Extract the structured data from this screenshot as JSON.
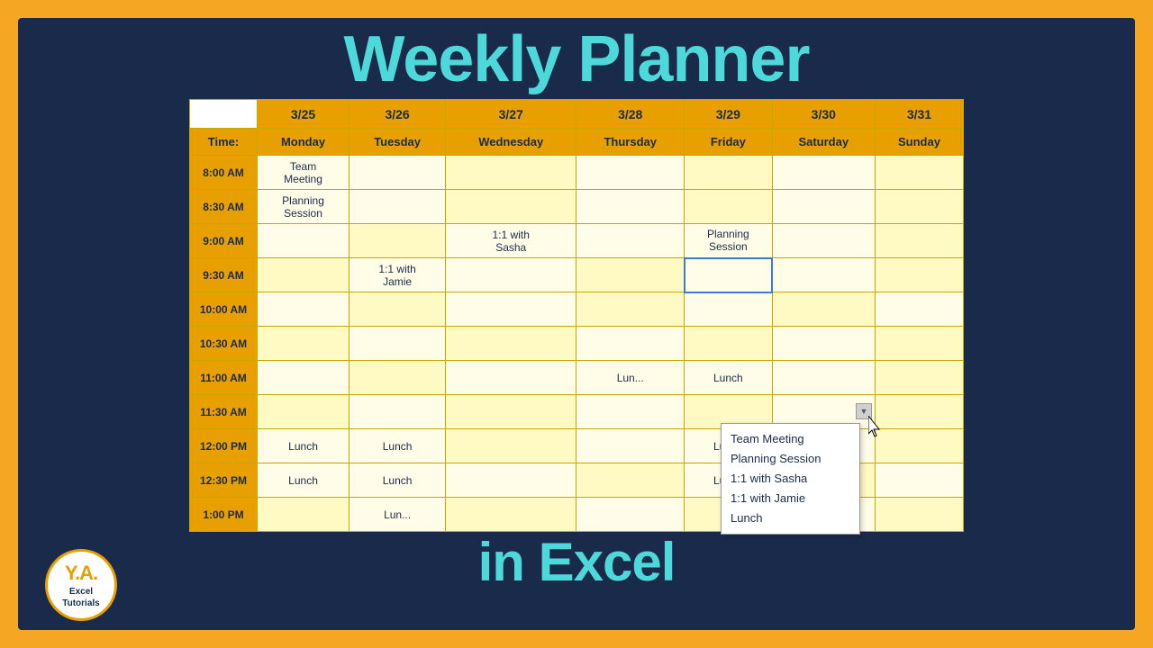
{
  "title": {
    "line1": "Weekly Planner",
    "line2": "in Excel"
  },
  "logo": {
    "ya": "Y.A.",
    "line1": "Excel",
    "line2": "Tutorials"
  },
  "calendar": {
    "dates": [
      "",
      "3/25",
      "3/26",
      "3/27",
      "3/28",
      "3/29",
      "3/30",
      "3/31"
    ],
    "days": [
      "Time:",
      "Monday",
      "Tuesday",
      "Wednesday",
      "Thursday",
      "Friday",
      "Saturday",
      "Sunday"
    ],
    "rows": [
      {
        "time": "8:00 AM",
        "mon": "Team\nMeeting",
        "tue": "",
        "wed": "",
        "thu": "",
        "fri": "",
        "sat": "",
        "sun": ""
      },
      {
        "time": "8:30 AM",
        "mon": "Planning\nSession",
        "tue": "",
        "wed": "",
        "thu": "",
        "fri": "",
        "sat": "",
        "sun": ""
      },
      {
        "time": "9:00 AM",
        "mon": "",
        "tue": "",
        "wed": "1:1 with\nSasha",
        "thu": "",
        "fri": "Planning\nSession",
        "sat": "",
        "sun": ""
      },
      {
        "time": "9:30 AM",
        "mon": "",
        "tue": "1:1 with\nJamie",
        "wed": "",
        "thu": "",
        "fri": "",
        "sat": "",
        "sun": ""
      },
      {
        "time": "10:00 AM",
        "mon": "",
        "tue": "",
        "wed": "",
        "thu": "",
        "fri": "",
        "sat": "",
        "sun": ""
      },
      {
        "time": "10:30 AM",
        "mon": "",
        "tue": "",
        "wed": "",
        "thu": "",
        "fri": "",
        "sat": "",
        "sun": ""
      },
      {
        "time": "11:00 AM",
        "mon": "",
        "tue": "",
        "wed": "",
        "thu": "Lun...",
        "fri": "Lunch",
        "sat": "",
        "sun": ""
      },
      {
        "time": "11:30 AM",
        "mon": "",
        "tue": "",
        "wed": "",
        "thu": "",
        "fri": "",
        "sat": "",
        "sun": ""
      },
      {
        "time": "12:00 PM",
        "mon": "Lunch",
        "tue": "Lunch",
        "wed": "",
        "thu": "",
        "fri": "Lunch",
        "sat": "",
        "sun": ""
      },
      {
        "time": "12:30 PM",
        "mon": "Lunch",
        "tue": "Lunch",
        "wed": "",
        "thu": "",
        "fri": "Lunch",
        "sat": "",
        "sun": ""
      },
      {
        "time": "1:00 PM",
        "mon": "",
        "tue": "Lun...",
        "wed": "",
        "thu": "",
        "fri": "",
        "sat": "",
        "sun": ""
      }
    ]
  },
  "tooltip": {
    "items": [
      "Team Meeting",
      "Planning Session",
      "1:1 with Sasha",
      "1:1 with Jamie",
      "Lunch"
    ]
  }
}
